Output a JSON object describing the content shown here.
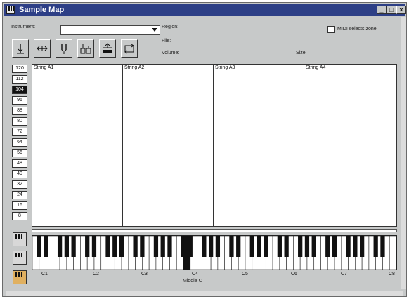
{
  "window": {
    "title": "Sample Map",
    "controls": {
      "minimize": "_",
      "maximize": "□",
      "close": "×"
    }
  },
  "header": {
    "instrument_label": "Instrument:",
    "instrument_value": "",
    "region_label": "Region:",
    "file_label": "File:",
    "volume_label": "Volume:",
    "size_label": "Size:",
    "midi_selects_zone_label": "MIDI selects zone",
    "midi_selects_zone_checked": false
  },
  "toolbar": {
    "icons": [
      "split-vertical-icon",
      "split-horizontal-icon",
      "tuning-fork-icon",
      "waveform-stack-icon",
      "stack-up-icon",
      "loop-arrows-icon"
    ]
  },
  "velocity": {
    "values": [
      "120",
      "112",
      "104",
      "96",
      "88",
      "80",
      "72",
      "64",
      "56",
      "48",
      "40",
      "32",
      "24",
      "16",
      "8"
    ],
    "selected": "104"
  },
  "zones": [
    {
      "label": "String A1"
    },
    {
      "label": "String A2"
    },
    {
      "label": "String A3"
    },
    {
      "label": "String A4"
    }
  ],
  "keyboard": {
    "octave_labels": [
      "C1",
      "C2",
      "C3",
      "C4",
      "C5",
      "C6",
      "C7",
      "C8"
    ],
    "middle_label": "Middle C"
  },
  "colors": {
    "titlebar": "#2d3f86",
    "window_bg": "#c7c9c9"
  }
}
